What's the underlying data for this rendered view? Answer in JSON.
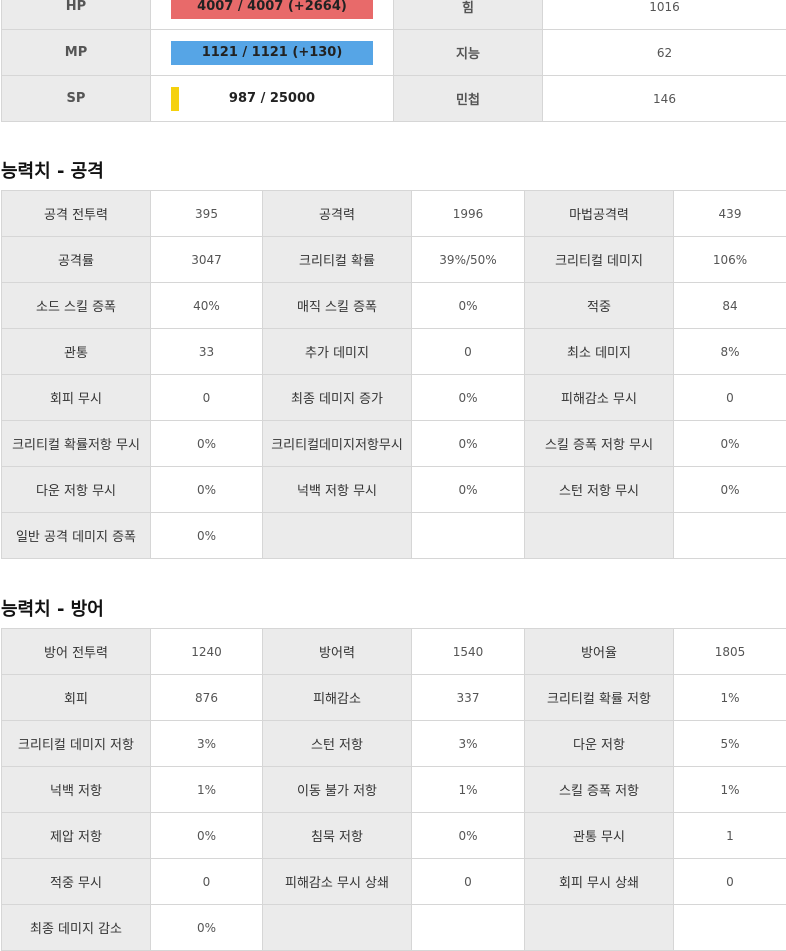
{
  "vitals": {
    "hp": {
      "label": "HP",
      "value": "4007 / 4007 (+2664)",
      "fill_ratio": 1.0,
      "color": "#e86a6a"
    },
    "mp": {
      "label": "MP",
      "value": "1121 / 1121 (+130)",
      "fill_ratio": 1.0,
      "color": "#56a5e6"
    },
    "sp": {
      "label": "SP",
      "value": "987 / 25000",
      "fill_ratio": 0.0395,
      "color": "#f5d10d"
    },
    "stats": [
      {
        "label": "힘",
        "value": "1016"
      },
      {
        "label": "지능",
        "value": "62"
      },
      {
        "label": "민첩",
        "value": "146"
      }
    ]
  },
  "attack": {
    "title": "능력치 - 공격",
    "rows": [
      [
        {
          "label": "공격 전투력",
          "value": "395"
        },
        {
          "label": "공격력",
          "value": "1996"
        },
        {
          "label": "마법공격력",
          "value": "439"
        }
      ],
      [
        {
          "label": "공격률",
          "value": "3047"
        },
        {
          "label": "크리티컬 확률",
          "value": "39%/50%"
        },
        {
          "label": "크리티컬 데미지",
          "value": "106%"
        }
      ],
      [
        {
          "label": "소드 스킬 증폭",
          "value": "40%"
        },
        {
          "label": "매직 스킬 증폭",
          "value": "0%"
        },
        {
          "label": "적중",
          "value": "84"
        }
      ],
      [
        {
          "label": "관통",
          "value": "33"
        },
        {
          "label": "추가 데미지",
          "value": "0"
        },
        {
          "label": "최소 데미지",
          "value": "8%"
        }
      ],
      [
        {
          "label": "회피 무시",
          "value": "0"
        },
        {
          "label": "최종 데미지 증가",
          "value": "0%"
        },
        {
          "label": "피해감소 무시",
          "value": "0"
        }
      ],
      [
        {
          "label": "크리티컬 확률저항 무시",
          "value": "0%"
        },
        {
          "label": "크리티컬데미지저항무시",
          "value": "0%"
        },
        {
          "label": "스킬 증폭 저항 무시",
          "value": "0%"
        }
      ],
      [
        {
          "label": "다운 저항 무시",
          "value": "0%"
        },
        {
          "label": "넉백 저항 무시",
          "value": "0%"
        },
        {
          "label": "스턴 저항 무시",
          "value": "0%"
        }
      ],
      [
        {
          "label": "일반 공격 데미지 증폭",
          "value": "0%"
        },
        null,
        null
      ]
    ]
  },
  "defense": {
    "title": "능력치 - 방어",
    "rows": [
      [
        {
          "label": "방어 전투력",
          "value": "1240"
        },
        {
          "label": "방어력",
          "value": "1540"
        },
        {
          "label": "방어율",
          "value": "1805"
        }
      ],
      [
        {
          "label": "회피",
          "value": "876"
        },
        {
          "label": "피해감소",
          "value": "337"
        },
        {
          "label": "크리티컬 확률 저항",
          "value": "1%"
        }
      ],
      [
        {
          "label": "크리티컬 데미지 저항",
          "value": "3%"
        },
        {
          "label": "스턴 저항",
          "value": "3%"
        },
        {
          "label": "다운 저항",
          "value": "5%"
        }
      ],
      [
        {
          "label": "넉백 저항",
          "value": "1%"
        },
        {
          "label": "이동 불가 저항",
          "value": "1%"
        },
        {
          "label": "스킬 증폭 저항",
          "value": "1%"
        }
      ],
      [
        {
          "label": "제압 저항",
          "value": "0%"
        },
        {
          "label": "침묵 저항",
          "value": "0%"
        },
        {
          "label": "관통 무시",
          "value": "1"
        }
      ],
      [
        {
          "label": "적중 무시",
          "value": "0"
        },
        {
          "label": "피해감소 무시 상쇄",
          "value": "0"
        },
        {
          "label": "회피 무시 상쇄",
          "value": "0"
        }
      ],
      [
        {
          "label": "최종 데미지 감소",
          "value": "0%"
        },
        null,
        null
      ]
    ]
  }
}
